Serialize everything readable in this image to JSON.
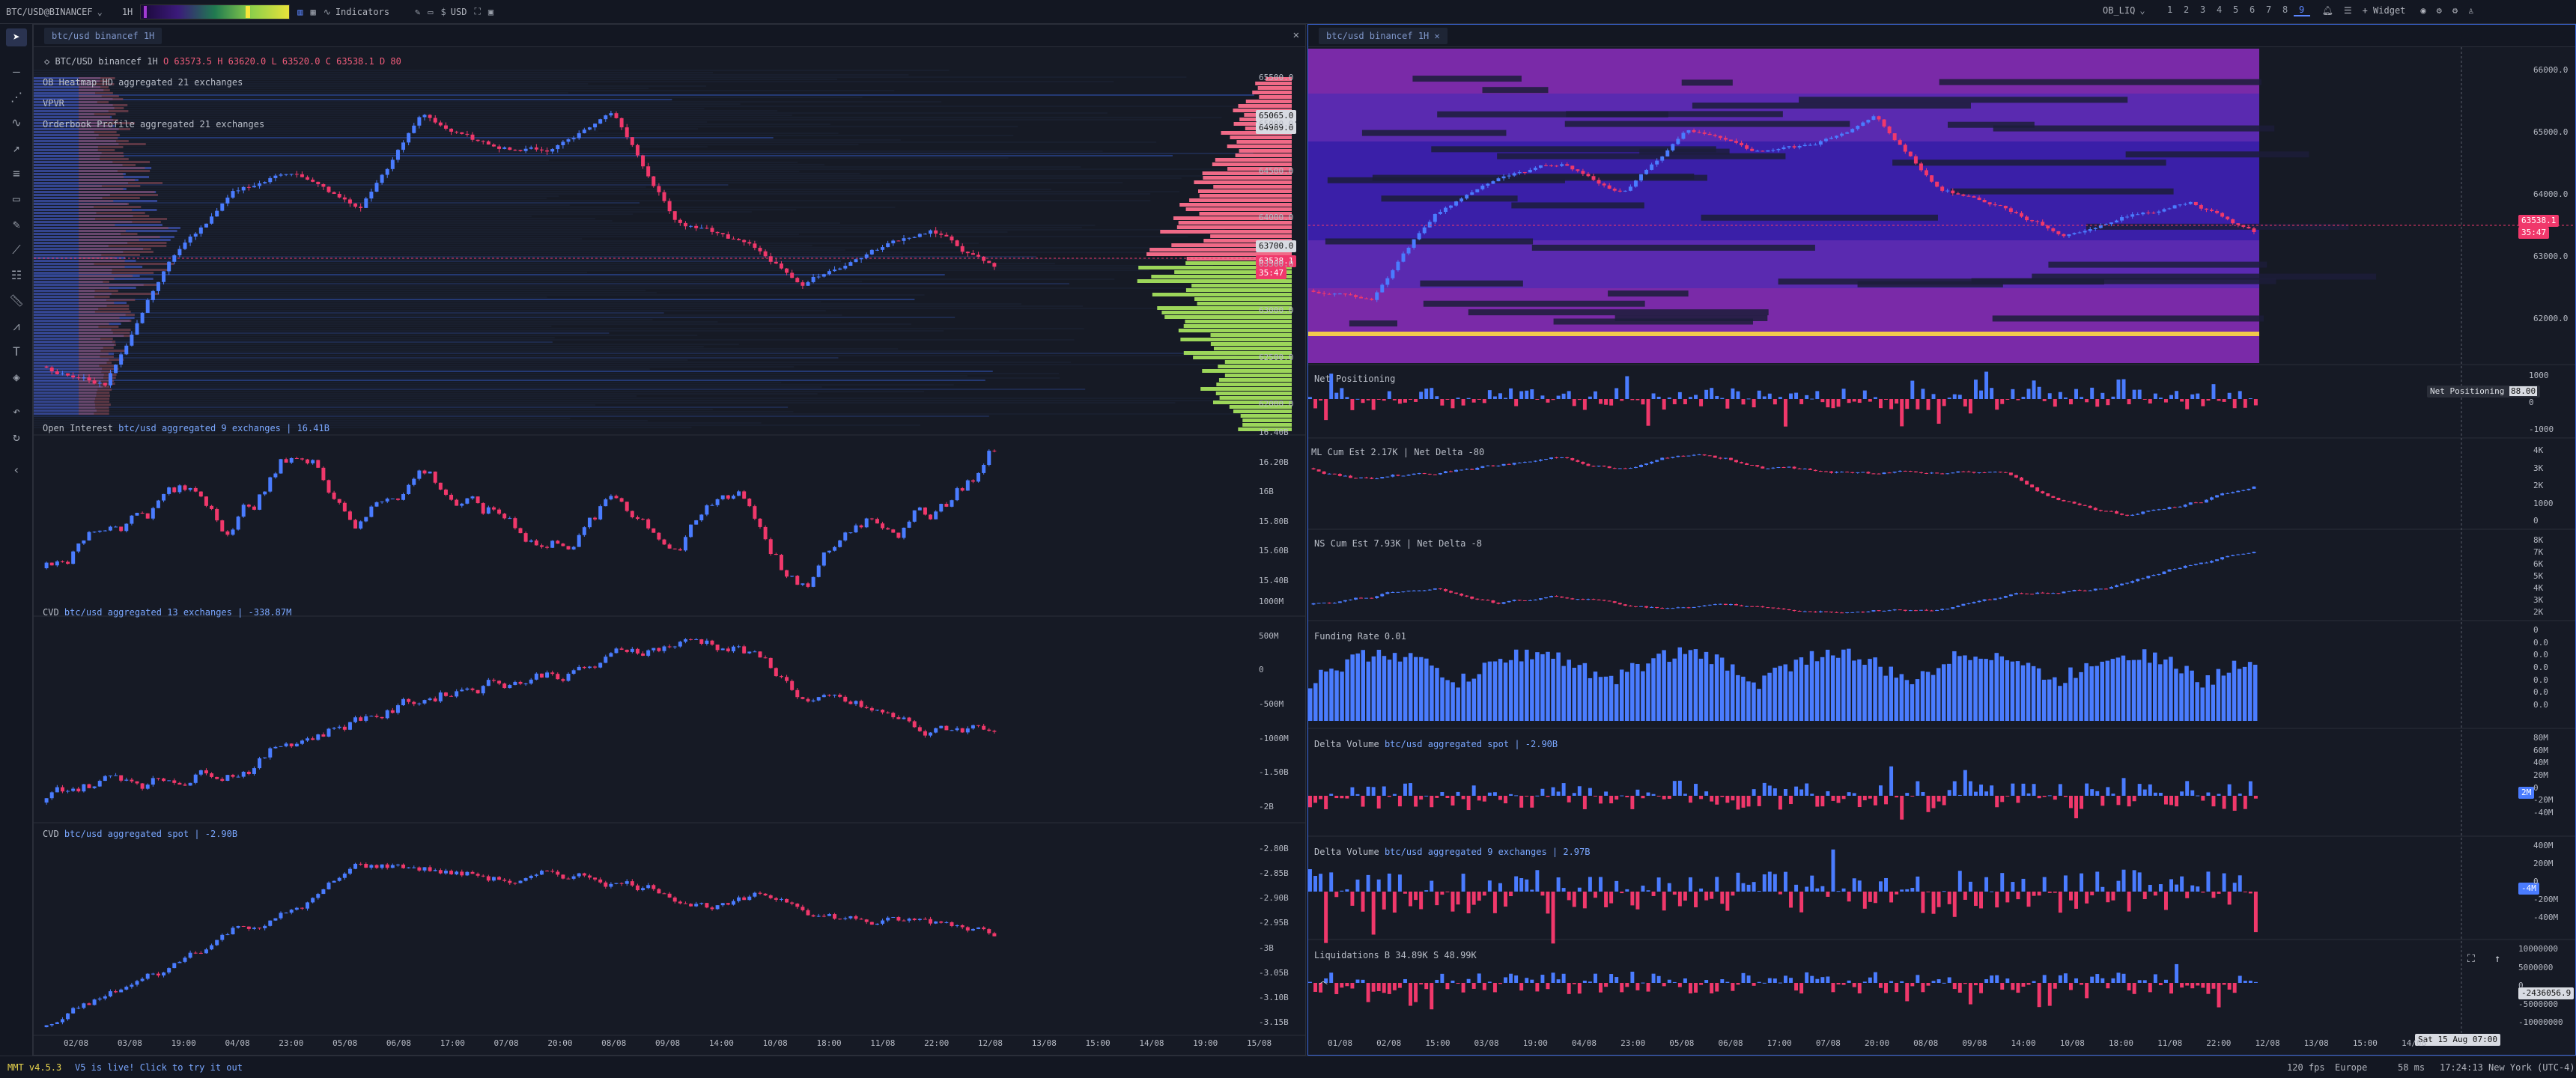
{
  "topbar": {
    "symbol": "BTC/USD@BINANCEF",
    "interval": "1H",
    "indicators": "Indicators",
    "currency": "USD",
    "layout": "OB_LIQ",
    "layouts": [
      "1",
      "2",
      "3",
      "4",
      "5",
      "6",
      "7",
      "8",
      "9"
    ],
    "widget": "+ Widget"
  },
  "left": {
    "tab": "btc/usd binancef 1H",
    "ohlc": "BTC/USD binancef 1H O 63573.5 H 63620.0 L 63520.0 C 63538.1 D 80",
    "ohlc_parts": {
      "title": "BTC/USD binancef 1H",
      "values": "O 63573.5 H 63620.0 L 63520.0 C 63538.1 D 80"
    },
    "heatmap_label": "OB Heatmap HD aggregated 21 exchanges",
    "vpvr": "VPVR",
    "profile_label": "Orderbook Profile aggregated 21 exchanges",
    "price_ticks": [
      "65500.0",
      "65000.0",
      "64500.0",
      "64000.0",
      "63500.0",
      "63000.0",
      "62500.0",
      "62000.0"
    ],
    "price_tags": {
      "a": "65065.0",
      "b": "64989.0",
      "c": "63700.0",
      "d": "63538.1",
      "e": "35:47"
    },
    "oi_label": {
      "name": "Open Interest",
      "desc": "btc/usd aggregated 9 exchanges | 16.41B"
    },
    "oi_ticks": [
      "16.40B",
      "16.20B",
      "16B",
      "15.80B",
      "15.60B",
      "15.40B"
    ],
    "cvd1_label": {
      "name": "CVD",
      "desc": "btc/usd aggregated 13 exchanges | -338.87M"
    },
    "cvd1_ticks": [
      "1000M",
      "500M",
      "0",
      "-500M",
      "-1000M",
      "-1.50B",
      "-2B"
    ],
    "cvd2_label": {
      "name": "CVD",
      "desc": "btc/usd aggregated spot | -2.90B"
    },
    "cvd2_ticks": [
      "-2.80B",
      "-2.85B",
      "-2.90B",
      "-2.95B",
      "-3B",
      "-3.05B",
      "-3.10B",
      "-3.15B"
    ],
    "time_ticks": [
      "02/08",
      "03/08",
      "19:00",
      "04/08",
      "23:00",
      "05/08",
      "06/08",
      "17:00",
      "07/08",
      "20:00",
      "08/08",
      "09/08",
      "14:00",
      "10/08",
      "18:00",
      "11/08",
      "22:00",
      "12/08",
      "13/08",
      "15:00",
      "14/08",
      "19:00",
      "15/08"
    ]
  },
  "right": {
    "tab": "btc/usd binancef 1H",
    "price_ticks": [
      "66000.0",
      "65000.0",
      "64000.0",
      "63000.0",
      "62000.0"
    ],
    "price_tags": {
      "a": "63538.1",
      "b": "35:47"
    },
    "net_label": "Net Positioning",
    "net_tag": "Net Positioning",
    "net_tag_val": "88.00",
    "net_ticks": [
      "1000",
      "0",
      "-1000"
    ],
    "ml_label": "ML Cum Est  2.17K | Net Delta -80",
    "ml_ticks": [
      "4K",
      "3K",
      "2K",
      "1000",
      "0"
    ],
    "ns_label": "NS Cum Est  7.93K | Net Delta -8",
    "ns_ticks": [
      "8K",
      "7K",
      "6K",
      "5K",
      "4K",
      "3K",
      "2K"
    ],
    "fund_label": "Funding Rate  0.01",
    "fund_ticks": [
      "0",
      "0.0",
      "0.0",
      "0.0",
      "0.0",
      "0.0",
      "0.0"
    ],
    "dv1_label": {
      "name": "Delta Volume",
      "desc": "btc/usd aggregated spot | -2.90B"
    },
    "dv1_ticks": [
      "80M",
      "60M",
      "40M",
      "20M",
      "0",
      "-20M",
      "-40M"
    ],
    "dv1_tag": "2M",
    "dv2_label": {
      "name": "Delta Volume",
      "desc": "btc/usd aggregated 9 exchanges | 2.97B"
    },
    "dv2_ticks": [
      "400M",
      "200M",
      "0",
      "-200M",
      "-400M"
    ],
    "dv2_tag": "-4M",
    "liq_label": "Liquidations  B 34.89K  S 48.99K",
    "liq_ticks": [
      "10000000",
      "5000000",
      "0",
      "-5000000",
      "-10000000"
    ],
    "liq_tag": "-2436056.9",
    "time_ticks": [
      "01/08",
      "02/08",
      "15:00",
      "03/08",
      "19:00",
      "04/08",
      "23:00",
      "05/08",
      "06/08",
      "17:00",
      "07/08",
      "20:00",
      "08/08",
      "09/08",
      "14:00",
      "10/08",
      "18:00",
      "11/08",
      "22:00",
      "12/08",
      "13/08",
      "15:00",
      "14/08"
    ],
    "cursor_time": "Sat 15 Aug 07:00"
  },
  "status": {
    "version": "MMT v4.5.3",
    "notice": "V5 is live! Click to try it out",
    "fps": "120 fps",
    "region": "Europe",
    "latency": "58 ms",
    "clock": "17:24:13 New York (UTC-4)"
  },
  "colors": {
    "up": "#4a7cff",
    "down": "#f0386b",
    "bg": "#161a25"
  }
}
